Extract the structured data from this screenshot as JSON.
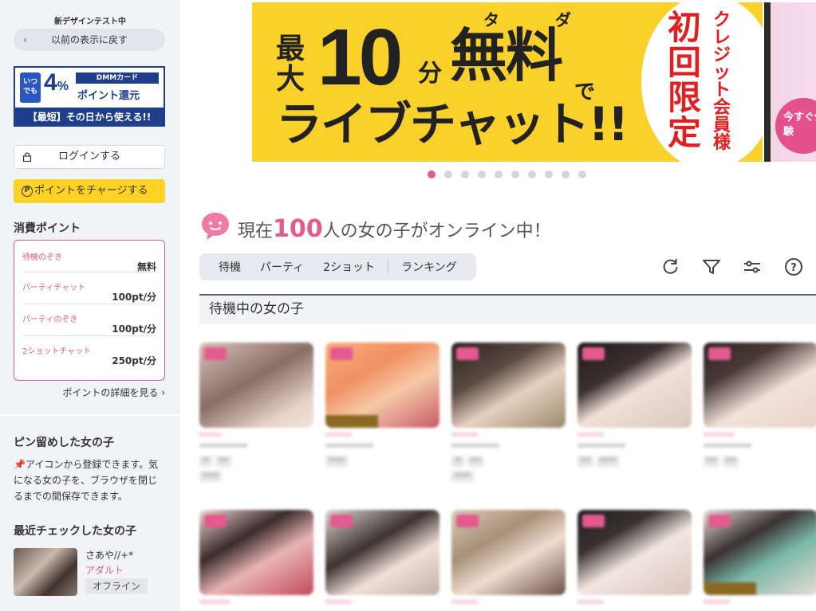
{
  "sidebar": {
    "notice": "新デザインテスト中",
    "back_label": "以前の表示に戻す",
    "banner": {
      "itsudemo": "いつでも",
      "percent": "4",
      "percent_unit": "%",
      "dmm_card": "DMMカード",
      "kangen": "ポイント還元",
      "bottom": "【最短】その日から使える!!"
    },
    "login_label": "ログインする",
    "charge_label": "ポイントをチャージする",
    "points_title": "消費ポイント",
    "points": [
      {
        "label": "待機のぞき",
        "value": "無料"
      },
      {
        "label": "パーティチャット",
        "value": "100pt/分"
      },
      {
        "label": "パーティのぞき",
        "value": "100pt/分"
      },
      {
        "label": "2ショットチャット",
        "value": "250pt/分"
      }
    ],
    "points_detail_link": "ポイントの詳細を見る",
    "pinned_title": "ピン留めした女の子",
    "pinned_text": "アイコンから登録できます。気になる女の子を、ブラウザを閉じるまでの間保存できます。",
    "recent_title": "最近チェックした女の子",
    "recent": {
      "name": "さあや//+*",
      "category": "アダルト",
      "status": "オフライン"
    }
  },
  "hero": {
    "saidai": "最大",
    "ten": "10",
    "fun": "分",
    "muryou": "無料",
    "ruby_ta": "タ",
    "ruby_da": "ダ",
    "de": "で",
    "live": "ライブチャット!!",
    "shokai": "初回限定",
    "credit": "クレジット会員様",
    "right_badge": "今すぐ体験"
  },
  "carousel": {
    "count": 10,
    "active_index": 0
  },
  "online": {
    "prefix": "現在",
    "count": "100",
    "suffix": "人の女の子がオンライン中！"
  },
  "tabs": [
    "待機",
    "パーティ",
    "2ショット",
    "ランキング"
  ],
  "tools": [
    "refresh-icon",
    "filter-icon",
    "settings-sliders-icon",
    "help-icon"
  ],
  "section_title": "待機中の女の子",
  "colors": {
    "accent_pink": "#e45a8e",
    "charge_yellow": "#ffd224",
    "hero_yellow": "#f9d12a",
    "sidebar_bg": "#f1f3f6"
  }
}
